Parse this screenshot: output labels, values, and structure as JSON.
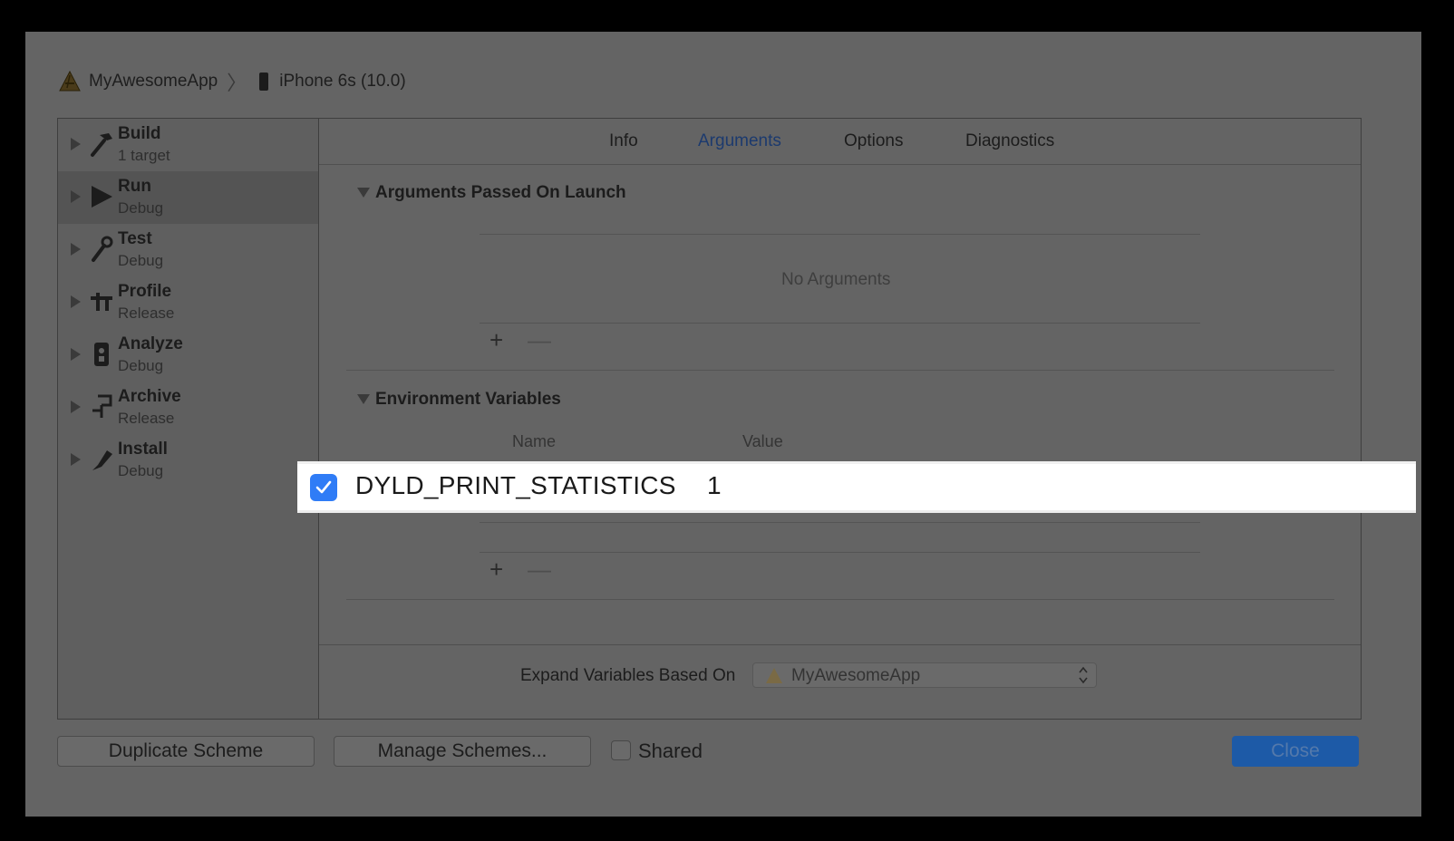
{
  "breadcrumb": {
    "app_name": "MyAwesomeApp",
    "app_icon": "xcode-app-icon",
    "device_icon": "iphone-icon",
    "device": "iPhone 6s (10.0)"
  },
  "sidebar": {
    "items": [
      {
        "name": "Build",
        "sub": "1 target",
        "icon": "hammer-icon"
      },
      {
        "name": "Run",
        "sub": "Debug",
        "icon": "play-icon"
      },
      {
        "name": "Test",
        "sub": "Debug",
        "icon": "wrench-icon"
      },
      {
        "name": "Profile",
        "sub": "Release",
        "icon": "caliper-icon"
      },
      {
        "name": "Analyze",
        "sub": "Debug",
        "icon": "analyze-icon"
      },
      {
        "name": "Archive",
        "sub": "Release",
        "icon": "archive-icon"
      },
      {
        "name": "Install",
        "sub": "Debug",
        "icon": "install-icon"
      }
    ],
    "selected": "Run"
  },
  "tabs": [
    "Info",
    "Arguments",
    "Options",
    "Diagnostics"
  ],
  "active_tab": "Arguments",
  "arguments": {
    "title": "Arguments Passed On Launch",
    "empty_text": "No Arguments",
    "add_label": "+",
    "remove_label": "—"
  },
  "environment": {
    "title": "Environment Variables",
    "col_name": "Name",
    "col_value": "Value",
    "add_label": "+",
    "remove_label": "—",
    "rows": [
      {
        "enabled": true,
        "name": "DYLD_PRINT_STATISTICS",
        "value": "1"
      }
    ]
  },
  "expand": {
    "label": "Expand Variables Based On",
    "value": "MyAwesomeApp"
  },
  "footer": {
    "duplicate": "Duplicate Scheme",
    "manage": "Manage Schemes...",
    "shared": "Shared",
    "close": "Close"
  },
  "colors": {
    "accent": "#2f7cf6",
    "close_button": "#1d5aa7",
    "active_tab": "#1c3a6e"
  }
}
